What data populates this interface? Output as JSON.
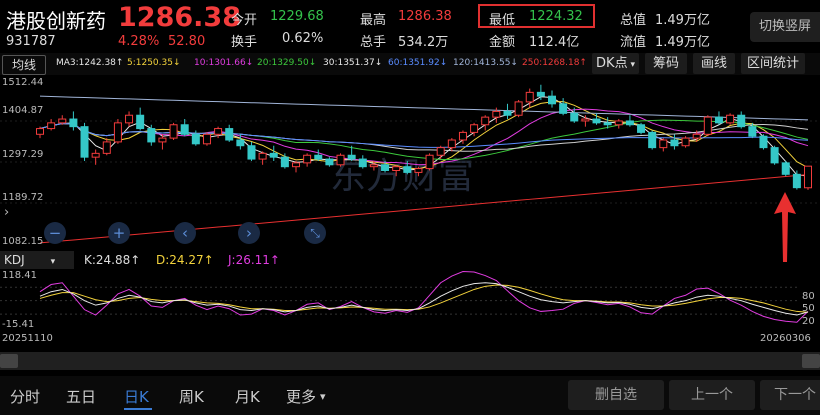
{
  "stock": {
    "name": "港股创新药",
    "code": "931787",
    "price": "1286.38",
    "pct": "4.28%",
    "change": "52.80"
  },
  "stats": [
    {
      "label": "今开",
      "value": "1229.68",
      "color": "green"
    },
    {
      "label": "换手",
      "value": "0.62%",
      "color": "white"
    },
    {
      "label": "最高",
      "value": "1286.38",
      "color": "red"
    },
    {
      "label": "总手",
      "value": "534.2万",
      "color": "white"
    },
    {
      "label": "最低",
      "value": "1224.32",
      "color": "green"
    },
    {
      "label": "金额",
      "value": "112.4亿",
      "color": "white"
    },
    {
      "label": "总值",
      "value": "1.49万亿",
      "color": "white"
    },
    {
      "label": "流值",
      "value": "1.49万亿",
      "color": "white"
    }
  ],
  "switch_button": "切换竖屏",
  "toolbar": {
    "ma_button": "均线",
    "ma": [
      {
        "text": "MA3:1242.38↑",
        "color": "#e8e8e8"
      },
      {
        "text": "5:1250.35↓",
        "color": "#f2d23c"
      },
      {
        "text": "10:1301.66↓",
        "color": "#e03ce0"
      },
      {
        "text": "20:1329.50↓",
        "color": "#3cc83c"
      },
      {
        "text": "30:1351.37↓",
        "color": "#e8e8e8"
      },
      {
        "text": "60:1351.92↓",
        "color": "#5a8cff"
      },
      {
        "text": "120:1413.55↓",
        "color": "#a0b4d8"
      },
      {
        "text": "250:1268.18↑",
        "color": "#f23c3c"
      }
    ],
    "dk": "DK点",
    "chips": "筹码",
    "draw": "画线",
    "range": "区间统计"
  },
  "price_axis": [
    "1512.44",
    "1404.87",
    "1297.29",
    "1189.72",
    "1082.15"
  ],
  "indicator": {
    "name": "KDJ",
    "k": "K:24.88↑",
    "d": "D:24.27↑",
    "j": "J:26.11↑",
    "axis_left": [
      "118.41",
      "-15.41"
    ],
    "axis_right": [
      "80",
      "50",
      "20"
    ]
  },
  "dates": {
    "start": "20251110",
    "end": "20260306"
  },
  "watermark": "东方财富",
  "tabs": [
    "分时",
    "五日",
    "日K",
    "周K",
    "月K",
    "更多"
  ],
  "active_tab": "日K",
  "bottom_buttons": [
    "删自选",
    "上一个",
    "下一个"
  ],
  "chart_data": {
    "type": "candlestick",
    "ylim": [
      1082.15,
      1512.44
    ],
    "candles": [
      [
        1370,
        1390,
        1360,
        1385
      ],
      [
        1385,
        1410,
        1380,
        1400
      ],
      [
        1400,
        1420,
        1395,
        1410
      ],
      [
        1410,
        1430,
        1380,
        1390
      ],
      [
        1390,
        1400,
        1300,
        1310
      ],
      [
        1310,
        1330,
        1290,
        1320
      ],
      [
        1320,
        1360,
        1315,
        1350
      ],
      [
        1350,
        1410,
        1345,
        1400
      ],
      [
        1400,
        1430,
        1390,
        1420
      ],
      [
        1420,
        1440,
        1380,
        1385
      ],
      [
        1385,
        1395,
        1340,
        1350
      ],
      [
        1350,
        1370,
        1330,
        1360
      ],
      [
        1360,
        1400,
        1355,
        1395
      ],
      [
        1395,
        1410,
        1365,
        1370
      ],
      [
        1370,
        1380,
        1340,
        1345
      ],
      [
        1345,
        1375,
        1340,
        1370
      ],
      [
        1370,
        1390,
        1360,
        1385
      ],
      [
        1385,
        1395,
        1350,
        1355
      ],
      [
        1355,
        1370,
        1330,
        1340
      ],
      [
        1340,
        1350,
        1300,
        1305
      ],
      [
        1305,
        1325,
        1290,
        1320
      ],
      [
        1320,
        1340,
        1300,
        1310
      ],
      [
        1310,
        1320,
        1280,
        1285
      ],
      [
        1285,
        1300,
        1270,
        1295
      ],
      [
        1295,
        1320,
        1285,
        1315
      ],
      [
        1315,
        1330,
        1300,
        1305
      ],
      [
        1305,
        1310,
        1285,
        1290
      ],
      [
        1290,
        1320,
        1285,
        1315
      ],
      [
        1315,
        1340,
        1300,
        1305
      ],
      [
        1305,
        1315,
        1280,
        1285
      ],
      [
        1285,
        1300,
        1275,
        1290
      ],
      [
        1290,
        1300,
        1270,
        1275
      ],
      [
        1275,
        1290,
        1260,
        1285
      ],
      [
        1285,
        1300,
        1265,
        1270
      ],
      [
        1270,
        1285,
        1260,
        1280
      ],
      [
        1280,
        1320,
        1275,
        1315
      ],
      [
        1315,
        1340,
        1305,
        1335
      ],
      [
        1335,
        1360,
        1325,
        1355
      ],
      [
        1355,
        1380,
        1345,
        1375
      ],
      [
        1375,
        1400,
        1365,
        1395
      ],
      [
        1395,
        1420,
        1380,
        1415
      ],
      [
        1415,
        1440,
        1400,
        1430
      ],
      [
        1430,
        1450,
        1410,
        1420
      ],
      [
        1420,
        1460,
        1415,
        1455
      ],
      [
        1455,
        1490,
        1440,
        1480
      ],
      [
        1480,
        1500,
        1460,
        1470
      ],
      [
        1470,
        1485,
        1440,
        1450
      ],
      [
        1450,
        1465,
        1420,
        1425
      ],
      [
        1425,
        1440,
        1400,
        1405
      ],
      [
        1405,
        1420,
        1390,
        1410
      ],
      [
        1410,
        1425,
        1395,
        1400
      ],
      [
        1400,
        1415,
        1385,
        1395
      ],
      [
        1395,
        1410,
        1385,
        1405
      ],
      [
        1405,
        1420,
        1390,
        1395
      ],
      [
        1395,
        1400,
        1370,
        1375
      ],
      [
        1375,
        1380,
        1330,
        1335
      ],
      [
        1335,
        1360,
        1325,
        1355
      ],
      [
        1355,
        1370,
        1330,
        1340
      ],
      [
        1340,
        1365,
        1335,
        1360
      ],
      [
        1360,
        1380,
        1350,
        1370
      ],
      [
        1370,
        1420,
        1365,
        1415
      ],
      [
        1415,
        1430,
        1395,
        1400
      ],
      [
        1400,
        1425,
        1395,
        1420
      ],
      [
        1420,
        1430,
        1385,
        1390
      ],
      [
        1390,
        1400,
        1360,
        1365
      ],
      [
        1365,
        1370,
        1330,
        1335
      ],
      [
        1335,
        1340,
        1290,
        1295
      ],
      [
        1295,
        1300,
        1260,
        1265
      ],
      [
        1265,
        1275,
        1225,
        1230
      ],
      [
        1229.68,
        1286.38,
        1224.32,
        1286.38
      ]
    ]
  },
  "kdj_data": {
    "range": [
      -15.41,
      118.41
    ],
    "k": [
      60,
      70,
      75,
      65,
      50,
      40,
      45,
      55,
      62,
      58,
      48,
      45,
      50,
      52,
      45,
      40,
      42,
      38,
      30,
      28,
      32,
      30,
      25,
      28,
      35,
      38,
      32,
      35,
      40,
      35,
      30,
      28,
      30,
      28,
      32,
      45,
      60,
      72,
      82,
      88,
      90,
      88,
      80,
      70,
      60,
      52,
      48,
      45,
      48,
      50,
      48,
      45,
      46,
      42,
      35,
      32,
      38,
      45,
      50,
      58,
      62,
      60,
      55,
      50,
      42,
      35,
      28,
      22,
      18,
      24.88
    ],
    "d": [
      55,
      62,
      68,
      68,
      60,
      52,
      48,
      50,
      55,
      57,
      53,
      50,
      50,
      51,
      48,
      45,
      44,
      41,
      36,
      32,
      32,
      31,
      28,
      28,
      31,
      34,
      33,
      34,
      36,
      35,
      33,
      31,
      31,
      30,
      31,
      36,
      45,
      55,
      65,
      75,
      82,
      85,
      84,
      80,
      73,
      65,
      58,
      52,
      50,
      50,
      49,
      47,
      47,
      45,
      41,
      38,
      38,
      40,
      44,
      49,
      54,
      57,
      57,
      55,
      50,
      45,
      38,
      31,
      26,
      24.27
    ],
    "j": [
      70,
      86,
      90,
      60,
      30,
      18,
      40,
      65,
      75,
      60,
      38,
      35,
      50,
      55,
      40,
      30,
      38,
      32,
      18,
      20,
      32,
      28,
      18,
      28,
      42,
      45,
      30,
      37,
      48,
      35,
      25,
      22,
      28,
      24,
      34,
      62,
      90,
      105,
      115,
      114,
      106,
      95,
      72,
      50,
      34,
      26,
      28,
      31,
      44,
      50,
      46,
      41,
      44,
      36,
      23,
      20,
      38,
      55,
      62,
      76,
      78,
      66,
      51,
      40,
      26,
      15,
      8,
      4,
      2,
      26.11
    ]
  }
}
